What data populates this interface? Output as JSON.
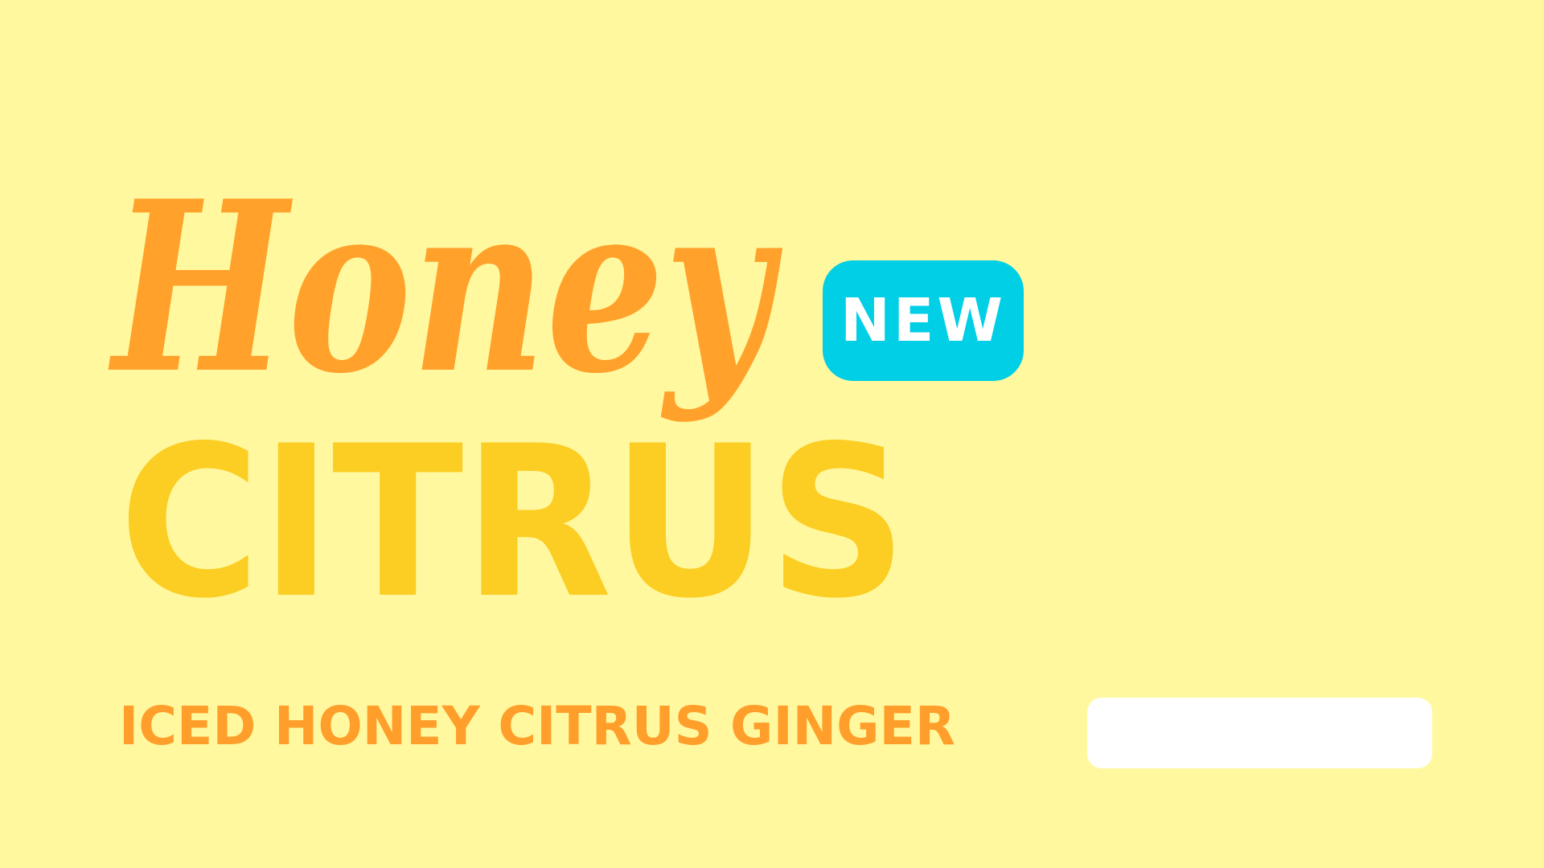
{
  "headline": {
    "script_word": "Honey",
    "badge": "NEW",
    "block_word": "CITRUS",
    "subtitle": "ICED HONEY CITRUS GINGER"
  },
  "colors": {
    "background": "#FFF89E",
    "script_orange": "#FFA12B",
    "citrus_yellow": "#FCCD22",
    "badge_cyan": "#00CFE6",
    "badge_text": "#FFFFFF",
    "subtitle_orange": "#FF9E2A",
    "panel_white": "#FFFFFF"
  }
}
